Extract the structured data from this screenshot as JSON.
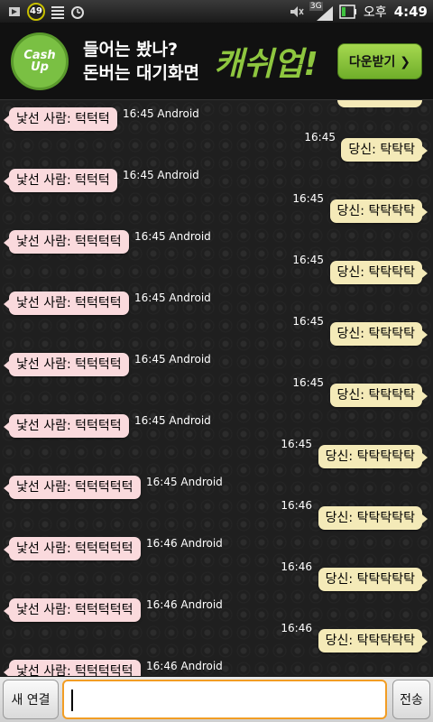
{
  "status_bar": {
    "battery_percent": "49",
    "network_label": "3G",
    "ampm": "오후",
    "time": "4:49",
    "icons": [
      "notification-icon",
      "battery-badge",
      "signal-bars-icon",
      "alarm-icon",
      "volume-mute-icon",
      "3g-signal-icon",
      "battery-icon"
    ]
  },
  "ad_banner": {
    "logo_text": "Cash Up",
    "line1": "들어는 봤나?",
    "line2": "돈버는 대기화면",
    "brand": "캐쉬업!",
    "download_label": "다운받기 ❯",
    "accent_color": "#8ec63f"
  },
  "chat": {
    "left_bubble_color": "#fadadd",
    "right_bubble_color": "#f4eab8",
    "messages": [
      {
        "side": "left",
        "text": "낯선 사람: 턱턱턱",
        "time": "16:45 Android"
      },
      {
        "side": "right",
        "text": "당신: 탁탁탁",
        "time": "16:45"
      },
      {
        "side": "left",
        "text": "낯선 사람: 턱턱턱",
        "time": "16:45 Android"
      },
      {
        "side": "right",
        "text": "당신: 탁탁탁탁",
        "time": "16:45"
      },
      {
        "side": "left",
        "text": "낯선 사람: 턱턱턱턱",
        "time": "16:45 Android"
      },
      {
        "side": "right",
        "text": "당신: 탁탁탁탁",
        "time": "16:45"
      },
      {
        "side": "left",
        "text": "낯선 사람: 턱턱턱턱",
        "time": "16:45 Android"
      },
      {
        "side": "right",
        "text": "당신: 탁탁탁탁",
        "time": "16:45"
      },
      {
        "side": "left",
        "text": "낯선 사람: 턱턱턱턱",
        "time": "16:45 Android"
      },
      {
        "side": "right",
        "text": "당신: 탁탁탁탁",
        "time": "16:45"
      },
      {
        "side": "left",
        "text": "낯선 사람: 턱턱턱턱",
        "time": "16:45 Android"
      },
      {
        "side": "right",
        "text": "당신: 탁탁탁탁탁",
        "time": "16:45"
      },
      {
        "side": "left",
        "text": "낯선 사람: 턱턱턱턱턱",
        "time": "16:45 Android"
      },
      {
        "side": "right",
        "text": "당신: 탁탁탁탁탁",
        "time": "16:46"
      },
      {
        "side": "left",
        "text": "낯선 사람: 턱턱턱턱턱",
        "time": "16:46 Android"
      },
      {
        "side": "right",
        "text": "당신: 탁탁탁탁탁",
        "time": "16:46"
      },
      {
        "side": "left",
        "text": "낯선 사람: 턱턱턱턱턱",
        "time": "16:46 Android"
      },
      {
        "side": "right",
        "text": "당신: 탁탁탁탁탁",
        "time": "16:46"
      },
      {
        "side": "left",
        "text": "낯선 사람: 턱턱턱턱턱",
        "time": "16:46 Android"
      }
    ]
  },
  "input_bar": {
    "new_connection_label": "새 연결",
    "message_value": "",
    "send_label": "전송"
  }
}
